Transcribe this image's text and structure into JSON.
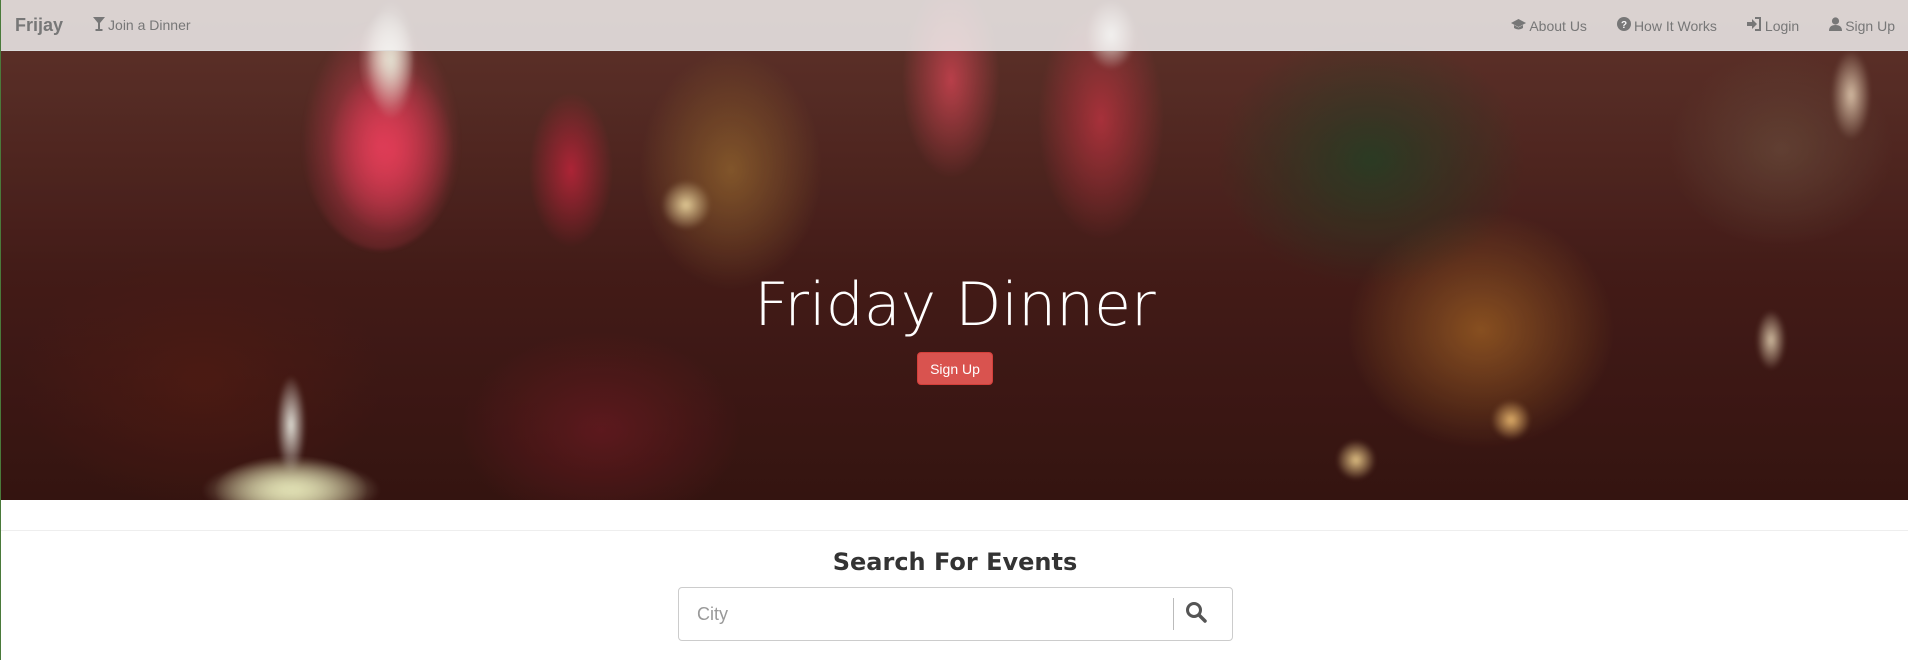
{
  "navbar": {
    "brand": "Frijay",
    "join_label": "Join a Dinner",
    "links": [
      {
        "label": "About Us",
        "icon": "graduation-cap-icon"
      },
      {
        "label": "How It Works",
        "icon": "question-circle-icon"
      },
      {
        "label": "Login",
        "icon": "log-in-icon"
      },
      {
        "label": "Sign Up",
        "icon": "user-icon"
      }
    ]
  },
  "hero": {
    "title": "Friday Dinner",
    "signup_label": "Sign Up",
    "button_color": "#d9534f"
  },
  "search": {
    "title": "Search For Events",
    "placeholder": "City",
    "value": "",
    "icon": "search-icon"
  }
}
